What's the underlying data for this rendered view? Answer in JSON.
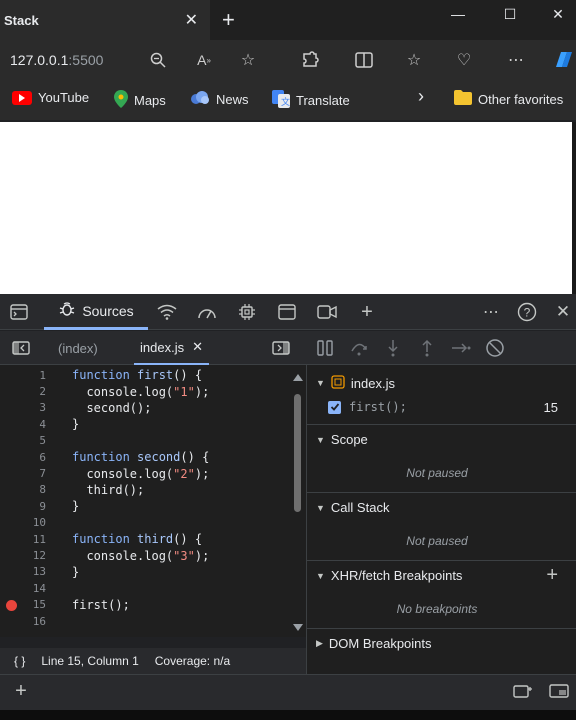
{
  "browser": {
    "tab_title": "Stack",
    "tab_close_icon": "✕",
    "new_tab_icon": "+",
    "window_controls": [
      "—",
      "☐",
      "✕"
    ],
    "url_host": "127.0.0.1",
    "url_port": ":5500"
  },
  "bookmarks": [
    {
      "label": "YouTube",
      "color": "#ff0000"
    },
    {
      "label": "Maps",
      "color": "#34a853"
    },
    {
      "label": "News",
      "color": "#4a7bd6"
    },
    {
      "label": "Translate",
      "color": "#4285f4"
    }
  ],
  "bookmarks_more": "›",
  "other_favorites": "Other favorites",
  "devtools": {
    "active_tab": "Sources",
    "editor_tabs": [
      "(index)",
      "index.js"
    ],
    "active_editor_tab_close": "✕",
    "accent": "#8ab4f8",
    "code_lines": [
      {
        "n": "1",
        "html": "<span class=\"kw\">function</span> <span class=\"fn\">first</span>() {"
      },
      {
        "n": "2",
        "html": "  console.log(<span class=\"str\">\"1\"</span>);"
      },
      {
        "n": "3",
        "html": "  second();"
      },
      {
        "n": "4",
        "html": "}"
      },
      {
        "n": "5",
        "html": ""
      },
      {
        "n": "6",
        "html": "<span class=\"kw\">function</span> <span class=\"fn\">second</span>() {"
      },
      {
        "n": "7",
        "html": "  console.log(<span class=\"str\">\"2\"</span>);"
      },
      {
        "n": "8",
        "html": "  third();"
      },
      {
        "n": "9",
        "html": "}"
      },
      {
        "n": "10",
        "html": ""
      },
      {
        "n": "11",
        "html": "<span class=\"kw\">function</span> <span class=\"fn\">third</span>() {"
      },
      {
        "n": "12",
        "html": "  console.log(<span class=\"str\">\"3\"</span>);"
      },
      {
        "n": "13",
        "html": "}"
      },
      {
        "n": "14",
        "html": ""
      },
      {
        "n": "15",
        "html": "first();",
        "breakpoint": true
      },
      {
        "n": "16",
        "html": ""
      }
    ],
    "status": {
      "braces": "{ }",
      "position": "Line 15, Column 1",
      "coverage": "Coverage: n/a"
    },
    "breakpoints": {
      "file": "index.js",
      "entry_code": "first();",
      "entry_line": "15"
    },
    "sections": {
      "scope": "Scope",
      "call_stack": "Call Stack",
      "xhr": "XHR/fetch Breakpoints",
      "dom": "DOM Breakpoints"
    },
    "scope_msg": "Not paused",
    "callstack_msg": "Not paused",
    "xhr_msg": "No breakpoints"
  }
}
